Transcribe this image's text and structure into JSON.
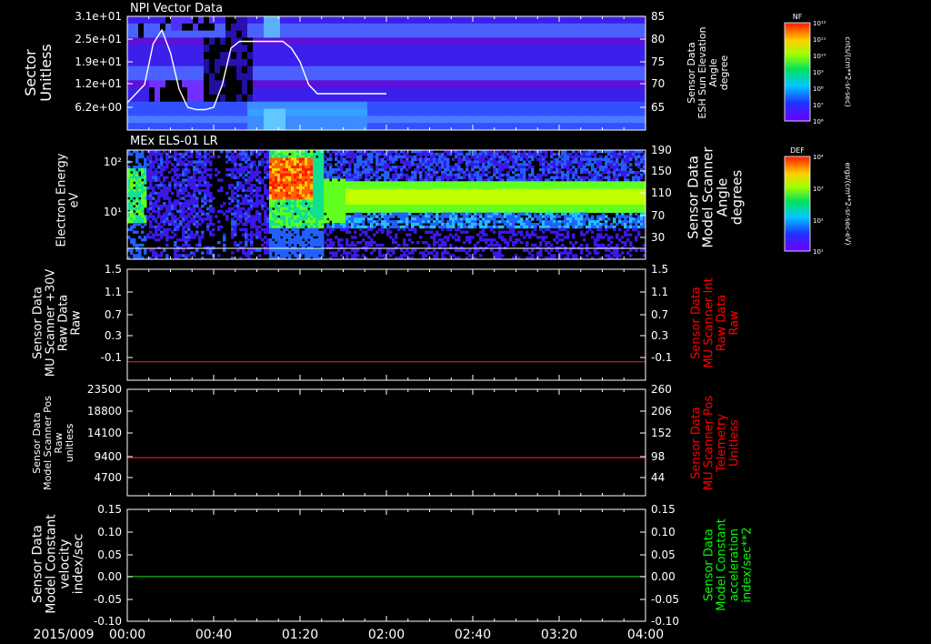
{
  "date_label": "2015/009",
  "time_ticks": [
    "00:00",
    "00:40",
    "01:20",
    "02:00",
    "02:40",
    "03:20",
    "04:00"
  ],
  "colors": {
    "background": "#000000",
    "text": "#ffffff",
    "red_axis": "#ff0000",
    "green_axis": "#00ff00",
    "red_line": "#e02020",
    "green_line": "#10d010"
  },
  "chart_data": [
    {
      "type": "heatmap",
      "title": "NPI Vector Data",
      "ylabel": [
        "Sector",
        "Unitless"
      ],
      "yticks": [
        "3.1e+01",
        "2.5e+01",
        "1.9e+01",
        "1.2e+01",
        "6.2e+00"
      ],
      "y2label": [
        "Sensor Data",
        "ESH Sun Elevation",
        "Angle",
        "degree"
      ],
      "y2ticks": [
        "85",
        "80",
        "75",
        "70",
        "65"
      ],
      "y2lim": [
        60,
        85
      ],
      "overlay_line": {
        "x_min": [
          0,
          8,
          12,
          16,
          20,
          24,
          28,
          32,
          36,
          40,
          44,
          48,
          52,
          56,
          60,
          64,
          68,
          72,
          76,
          80,
          84,
          88,
          92,
          96,
          100,
          104,
          108,
          112,
          116,
          120
        ],
        "y_deg": [
          66,
          70,
          79,
          82,
          77,
          69,
          65,
          64.5,
          64.5,
          65,
          70,
          78,
          79.5,
          79.5,
          79.5,
          79.5,
          79.5,
          79.5,
          78,
          75,
          70,
          68,
          68,
          68,
          68,
          68,
          68,
          68,
          68,
          68
        ]
      },
      "colorbar": {
        "label": "NF",
        "unit": "cnts/(cm**2-sr-sec)",
        "ticks": [
          "10¹²",
          "10¹¹",
          "10¹⁰",
          "10⁹",
          "10⁸",
          "10⁷",
          "10⁶"
        ]
      }
    },
    {
      "type": "heatmap",
      "title": "MEx ELS-01 LR",
      "ylabel": [
        "Electron Energy",
        "eV"
      ],
      "yticks": [
        "10²",
        "10¹"
      ],
      "y2label": [
        "Sensor Data",
        "Model Scanner",
        "Angle",
        "degrees"
      ],
      "y2ticks": [
        "190",
        "150",
        "110",
        "70",
        "30"
      ],
      "colorbar": {
        "label": "DEF",
        "unit": "ergs/(cm**2-sr-sec-eV)",
        "ticks": [
          "10⁴",
          "10³",
          "10²",
          "10¹"
        ]
      }
    },
    {
      "type": "line",
      "ylabel": [
        "Sensor Data",
        "MU Scanner +30V",
        "Raw Data",
        "Raw"
      ],
      "ylim": [
        -0.3,
        1.5
      ],
      "yticks": [
        "1.5",
        "1.1",
        "0.7",
        "0.3",
        "-0.1"
      ],
      "y2label": [
        "Sensor Data",
        "MU Scanner Int",
        "Raw Data",
        "Raw"
      ],
      "y2ticks": [
        "1.5",
        "1.1",
        "0.7",
        "0.3",
        "-0.1"
      ],
      "series": [
        {
          "x_min": [
            0,
            240
          ],
          "values": [
            0,
            0
          ]
        }
      ]
    },
    {
      "type": "line",
      "ylabel": [
        "Sensor Data",
        "Model Scanner Pos",
        "Raw",
        "unitless"
      ],
      "ylim": [
        0,
        23500
      ],
      "yticks": [
        "23500",
        "18800",
        "14100",
        "9400",
        "4700"
      ],
      "y2label": [
        "Sensor Data",
        "MU Scanner Pos",
        "Telemetry",
        "Unitless"
      ],
      "y2ticks": [
        "260",
        "206",
        "152",
        "98",
        "44"
      ],
      "series": [
        {
          "x_min": [
            0,
            240
          ],
          "values": [
            8400,
            8400
          ]
        }
      ]
    },
    {
      "type": "line",
      "ylabel": [
        "Sensor Data",
        "Model Constant",
        "velocity",
        "index/sec"
      ],
      "ylim": [
        -0.1,
        0.15
      ],
      "yticks": [
        "0.15",
        "0.10",
        "0.05",
        "0.00",
        "-0.05",
        "-0.10"
      ],
      "y2label": [
        "Sensor Data",
        "Model Constant",
        "acceleration",
        "index/sec**2"
      ],
      "y2ticks": [
        "0.15",
        "0.10",
        "0.05",
        "0.00",
        "-0.05",
        "-0.10"
      ],
      "series": [
        {
          "x_min": [
            0,
            240
          ],
          "values": [
            0,
            0
          ]
        }
      ]
    }
  ]
}
